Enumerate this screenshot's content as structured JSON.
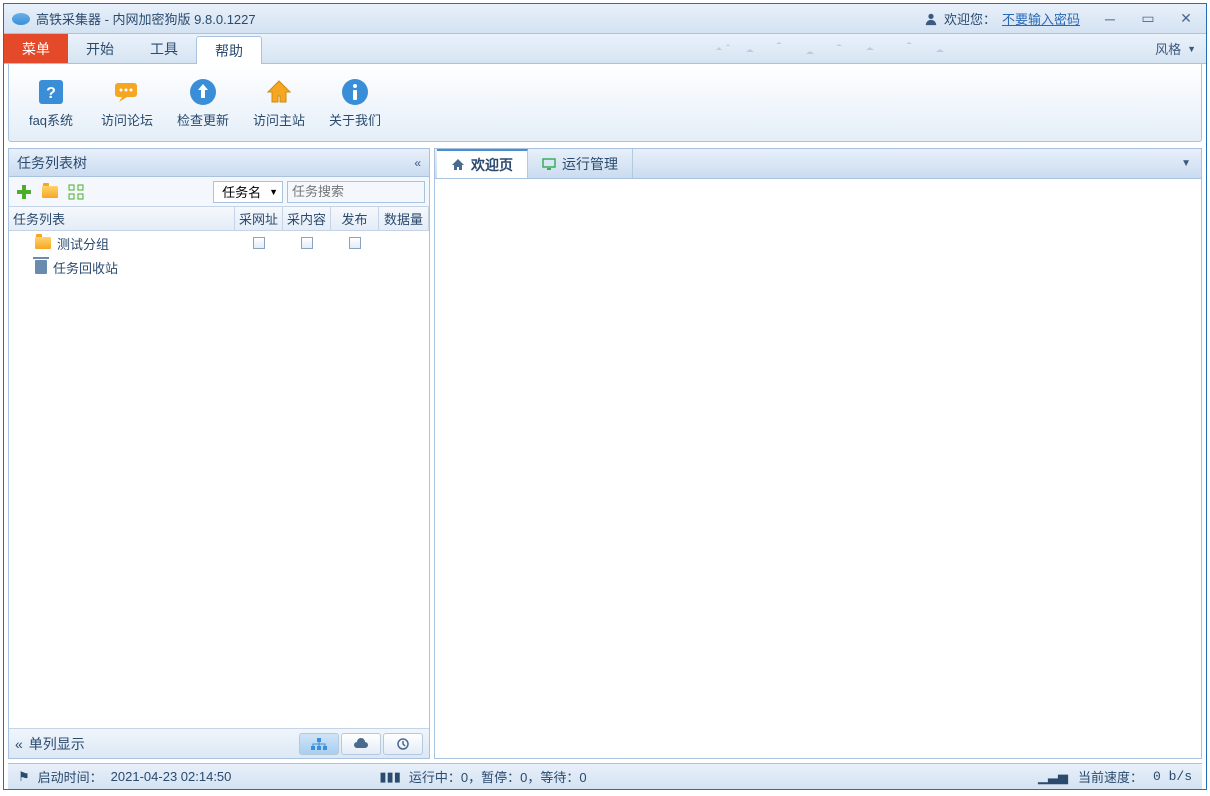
{
  "title": "高铁采集器 - 内网加密狗版 9.8.0.1227",
  "user": {
    "welcome": "欢迎您：",
    "link": "不要输入密码"
  },
  "menu": {
    "main": "菜单",
    "start": "开始",
    "tools": "工具",
    "help": "帮助",
    "style": "风格"
  },
  "ribbon": {
    "faq": "faq系统",
    "forum": "访问论坛",
    "update": "检查更新",
    "site": "访问主站",
    "about": "关于我们"
  },
  "left": {
    "header": "任务列表树",
    "filter_sel": "任务名",
    "search_placeholder": "任务搜索",
    "cols": {
      "task": "任务列表",
      "url": "采网址",
      "content": "采内容",
      "pub": "发布",
      "data": "数据量"
    },
    "rows": [
      {
        "icon": "folder",
        "name": "测试分组",
        "checks": true
      },
      {
        "icon": "trash",
        "name": "任务回收站",
        "checks": false
      }
    ],
    "footer": "单列显示"
  },
  "tabs": {
    "welcome": "欢迎页",
    "runmgr": "运行管理"
  },
  "status": {
    "start_label": "启动时间：",
    "start_time": "2021-04-23 02:14:50",
    "running": "运行中：0，暂停：0，等待：0",
    "speed_label": "当前速度：",
    "speed_val": "0 b/s"
  }
}
